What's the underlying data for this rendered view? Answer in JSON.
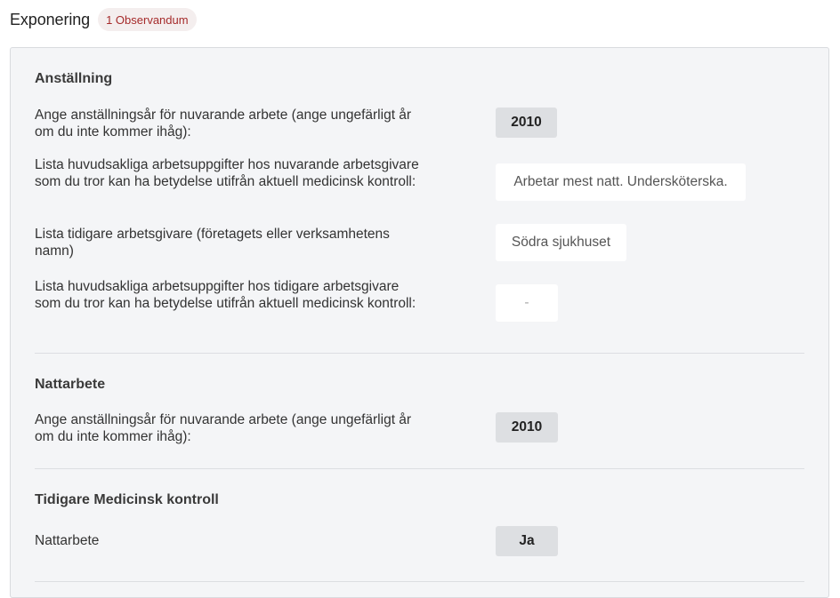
{
  "header": {
    "title": "Exponering",
    "badge": "1 Observandum"
  },
  "sections": [
    {
      "title": "Anställning",
      "rows": [
        {
          "question": "Ange anställningsår för nuvarande arbete (ange ungefärligt år om du inte kommer ihåg):",
          "answer": "2010"
        },
        {
          "question": "Lista huvudsakliga arbetsuppgifter hos nuvarande arbetsgivare som du tror kan ha betydelse utifrån aktuell medicinsk kontroll:",
          "answer": "Arbetar mest natt. Undersköterska."
        },
        {
          "question": "Lista tidigare arbetsgivare (företagets eller verksamhetens namn)",
          "answer": "Södra sjukhuset"
        },
        {
          "question": "Lista huvudsakliga arbetsuppgifter hos tidigare arbetsgivare som du tror kan ha betydelse utifrån aktuell medicinsk kontroll:",
          "answer": "-"
        }
      ]
    },
    {
      "title": "Nattarbete",
      "rows": [
        {
          "question": "Ange anställningsår för nuvarande arbete (ange ungefärligt år om du inte kommer ihåg):",
          "answer": "2010"
        }
      ]
    },
    {
      "title": "Tidigare Medicinsk kontroll",
      "rows": [
        {
          "question": "Nattarbete",
          "answer": "Ja"
        }
      ]
    }
  ]
}
